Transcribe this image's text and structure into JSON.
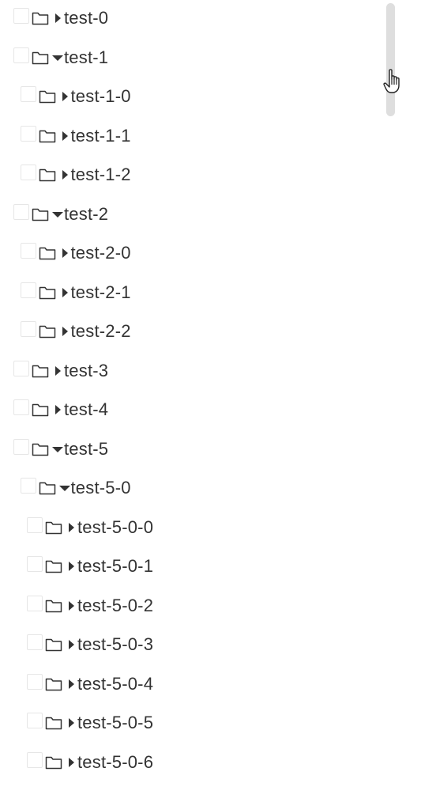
{
  "tree": {
    "nodes": [
      {
        "label": "test-0",
        "depth": 0,
        "expanded": false
      },
      {
        "label": "test-1",
        "depth": 0,
        "expanded": true
      },
      {
        "label": "test-1-0",
        "depth": 1,
        "expanded": false
      },
      {
        "label": "test-1-1",
        "depth": 1,
        "expanded": false
      },
      {
        "label": "test-1-2",
        "depth": 1,
        "expanded": false
      },
      {
        "label": "test-2",
        "depth": 0,
        "expanded": true
      },
      {
        "label": "test-2-0",
        "depth": 1,
        "expanded": false
      },
      {
        "label": "test-2-1",
        "depth": 1,
        "expanded": false
      },
      {
        "label": "test-2-2",
        "depth": 1,
        "expanded": false
      },
      {
        "label": "test-3",
        "depth": 0,
        "expanded": false
      },
      {
        "label": "test-4",
        "depth": 0,
        "expanded": false
      },
      {
        "label": "test-5",
        "depth": 0,
        "expanded": true
      },
      {
        "label": "test-5-0",
        "depth": 1,
        "expanded": true
      },
      {
        "label": "test-5-0-0",
        "depth": 2,
        "expanded": false
      },
      {
        "label": "test-5-0-1",
        "depth": 2,
        "expanded": false
      },
      {
        "label": "test-5-0-2",
        "depth": 2,
        "expanded": false
      },
      {
        "label": "test-5-0-3",
        "depth": 2,
        "expanded": false
      },
      {
        "label": "test-5-0-4",
        "depth": 2,
        "expanded": false
      },
      {
        "label": "test-5-0-5",
        "depth": 2,
        "expanded": false
      },
      {
        "label": "test-5-0-6",
        "depth": 2,
        "expanded": false
      }
    ],
    "icons": {
      "folder": "folder-icon",
      "caret_collapsed": "caret-right-icon",
      "caret_expanded": "caret-down-icon"
    }
  },
  "cursor": {
    "icon": "hand-pointer-icon"
  },
  "colors": {
    "text": "#333333",
    "checkbox_border": "#e6e6e6",
    "scrollbar_thumb": "#dedede"
  }
}
